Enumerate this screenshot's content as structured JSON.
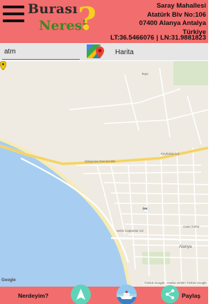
{
  "header": {
    "logo": {
      "line1": "Burası",
      "line2": "Neresi",
      "mark": "?"
    },
    "address_lines": [
      "Saray Mahallesi",
      "Atatürk Blv No:106",
      "07400 Alanya Antalya",
      "Türkiye"
    ],
    "latitude": "LT:36.5466076",
    "separator": "|",
    "longitude": "LN:31.9881823",
    "menu_icon": "hamburger-icon"
  },
  "search": {
    "value": "atm",
    "maps_icon": "google-maps-icon",
    "harita_label": "Harita"
  },
  "map": {
    "labels": {
      "tepe": "Tepe",
      "street_top": "Süleyman Demirel Blv",
      "keykubat": "Keykubat Cd",
      "sekiz": "Sekiz Kaptanlar Cd",
      "dn": "DN",
      "alanya": "Alanya",
      "camii": "Cami Türbe"
    },
    "google_logo": "Google",
    "credit": "©2016 Google - Harita verileri ©2016 Google",
    "water_color": "#a7cdf1",
    "beach_color": "#f6ebb3",
    "road_color": "#f7d970",
    "pin_color": "#f5c800"
  },
  "bottom": {
    "nerdeyim": "Nerdeyim?",
    "paylas": "Paylaş",
    "nav_icon": "navigation-arrow-icon",
    "boat_icon": "boat-icon",
    "share_icon": "share-icon"
  },
  "colors": {
    "brand_red": "#f26d6d",
    "accent_teal": "#5fd3b8"
  }
}
